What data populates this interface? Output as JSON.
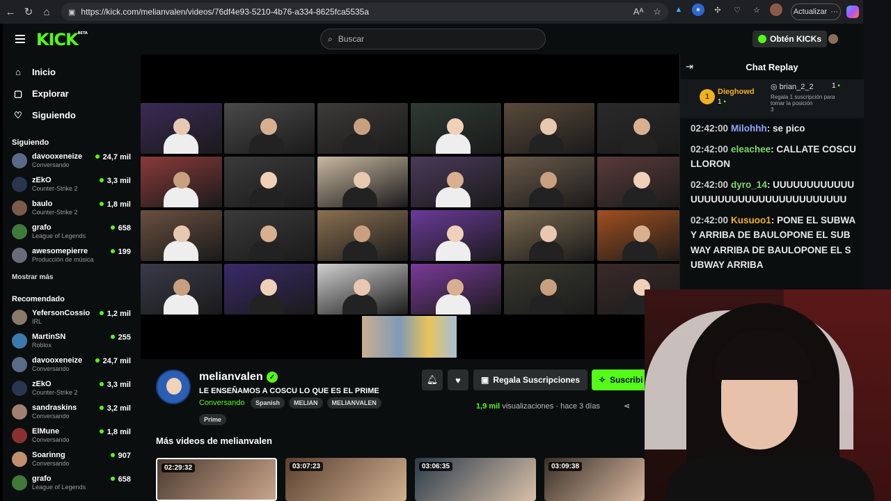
{
  "browser": {
    "url": "https://kick.com/melianvalen/videos/76df4e93-5210-4b76-a334-8625fca5535a",
    "update_label": "Actualizar"
  },
  "header": {
    "logo": "KICK",
    "logo_badge": "BETA",
    "search_placeholder": "Buscar",
    "get_kicks_label": "Obtén KICKs"
  },
  "sidebar": {
    "nav": [
      {
        "label": "Inicio",
        "icon": "home-icon"
      },
      {
        "label": "Explorar",
        "icon": "explore-icon"
      },
      {
        "label": "Siguiendo",
        "icon": "heart-icon"
      }
    ],
    "following_title": "Siguiendo",
    "following": [
      {
        "name": "davooxeneize",
        "category": "Conversando",
        "viewers": "24,7 mil",
        "color": "#5a6b8a"
      },
      {
        "name": "zEkO",
        "category": "Counter-Strike 2",
        "viewers": "3,3 mil",
        "color": "#2a3550"
      },
      {
        "name": "baulo",
        "category": "Counter-Strike 2",
        "viewers": "1,8 mil",
        "color": "#7a5a48"
      },
      {
        "name": "grafo",
        "category": "League of Legends",
        "viewers": "658",
        "color": "#3f7a3a"
      },
      {
        "name": "awesomepierre",
        "category": "Producción de música",
        "viewers": "199",
        "color": "#6a6a7a"
      }
    ],
    "show_more": "Mostrar más",
    "recommended_title": "Recomendado",
    "recommended": [
      {
        "name": "YefersonCossio",
        "category": "IRL",
        "viewers": "1,2 mil",
        "color": "#8a7a6a"
      },
      {
        "name": "MartinSN",
        "category": "Roblox",
        "viewers": "255",
        "color": "#3a7ab0"
      },
      {
        "name": "davooxeneize",
        "category": "Conversando",
        "viewers": "24,7 mil",
        "color": "#5a6b8a"
      },
      {
        "name": "zEkO",
        "category": "Counter-Strike 2",
        "viewers": "3,3 mil",
        "color": "#2a3550"
      },
      {
        "name": "sandraskins",
        "category": "Conversando",
        "viewers": "3,2 mil",
        "color": "#a08070"
      },
      {
        "name": "ElMune",
        "category": "Conversando",
        "viewers": "1,8 mil",
        "color": "#8a3030"
      },
      {
        "name": "Soarinng",
        "category": "Conversando",
        "viewers": "907",
        "color": "#c09070"
      },
      {
        "name": "grafo",
        "category": "League of Legends",
        "viewers": "658",
        "color": "#3f7a3a"
      }
    ]
  },
  "stream": {
    "channel": "melianvalen",
    "title": "LE ENSEÑAMOS A COSCU LO QUE ES EL PRIME",
    "category": "Conversando",
    "tags": [
      "Spanish",
      "MELIAN",
      "MELIANVALEN"
    ],
    "extra_tag": "Prime",
    "gift_label": "Regala Suscripciones",
    "subscribe_label": "Suscribi",
    "views_count": "1,9 mil",
    "views_label": "visualizaciones",
    "date": "hace 3 días",
    "more_videos_title": "Más videos de melianvalen",
    "videos": [
      {
        "duration": "02:29:32"
      },
      {
        "duration": "03:07:23"
      },
      {
        "duration": "03:06:35"
      },
      {
        "duration": "03:09:38"
      }
    ]
  },
  "chat": {
    "title": "Chat Replay",
    "leaders": [
      {
        "name": "Dieghowd",
        "count": "1"
      },
      {
        "name": "brian_2_2",
        "count": "1"
      }
    ],
    "leader_hint": "Regala 1 suscripción para tomar la posición",
    "leader_hint_pos": "3",
    "messages": [
      {
        "time": "02:42:00",
        "user": "Milohhh",
        "color": "#8fa3ff",
        "text": "se pico"
      },
      {
        "time": "02:42:00",
        "user": "eleachee",
        "color": "#7fd86e",
        "text": "CALLATE COSCU LLORON"
      },
      {
        "time": "02:42:00",
        "user": "dyro_14",
        "color": "#7fd86e",
        "text": "UUUUUUUUUUUUUUUUUUUUUUUUUUUUUUUUUUU"
      },
      {
        "time": "02:42:00",
        "user": "Kusuoo1",
        "color": "#f0b121",
        "text": "PONE EL SUBWAY ARRIBA DE BAULOPONE EL SUBWAY ARRIBA DE BAULOPONE EL SUBWAY ARRIBA"
      }
    ]
  }
}
